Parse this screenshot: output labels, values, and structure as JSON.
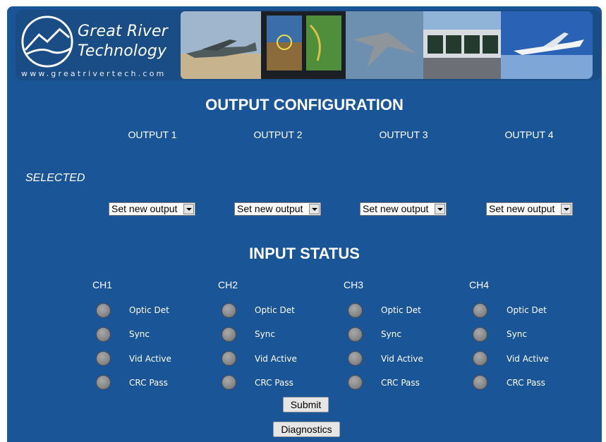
{
  "brand": {
    "line1": "Great River",
    "line2": "Technology",
    "url": "www.greatrivertech.com"
  },
  "output_config": {
    "title": "OUTPUT CONFIGURATION",
    "selected_label": "SELECTED",
    "outputs": [
      {
        "label": "OUTPUT 1",
        "select_value": "Set new output"
      },
      {
        "label": "OUTPUT 2",
        "select_value": "Set new output"
      },
      {
        "label": "OUTPUT 3",
        "select_value": "Set new output"
      },
      {
        "label": "OUTPUT 4",
        "select_value": "Set new output"
      }
    ]
  },
  "input_status": {
    "title": "INPUT STATUS",
    "channels": [
      {
        "label": "CH1"
      },
      {
        "label": "CH2"
      },
      {
        "label": "CH3"
      },
      {
        "label": "CH4"
      }
    ],
    "indicators": [
      "Optic Det",
      "Sync",
      "Vid Active",
      "CRC Pass"
    ],
    "indicator_color": "#8a8a8a"
  },
  "buttons": {
    "submit": "Submit",
    "diagnostics": "Diagnostics"
  },
  "colors": {
    "background": "#1a5597",
    "text": "#ffffff"
  }
}
